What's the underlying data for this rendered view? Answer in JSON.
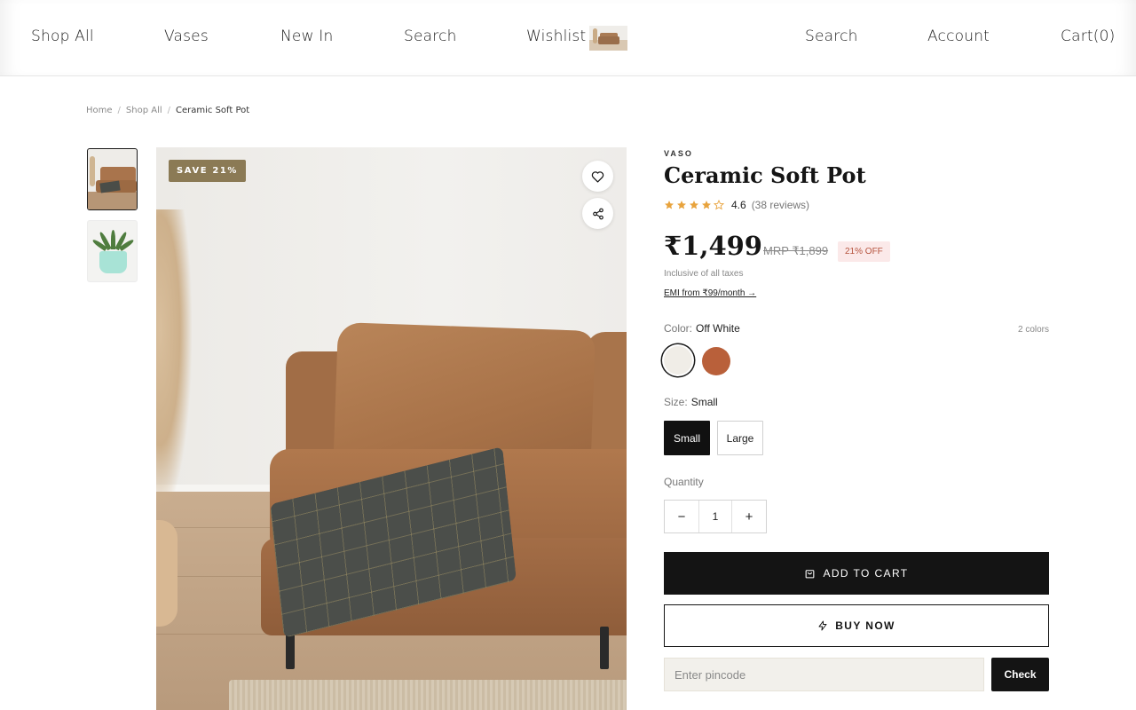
{
  "header": {
    "nav": [
      {
        "label": "Shop All"
      },
      {
        "label": "Vases"
      },
      {
        "label": "New In"
      },
      {
        "label": "Search"
      },
      {
        "label": "Wishlist"
      }
    ],
    "right_nav": [
      {
        "label": "Search"
      },
      {
        "label": "Account"
      },
      {
        "label": "Cart(0)"
      }
    ]
  },
  "breadcrumb": {
    "items": [
      "Home",
      "Shop All",
      "Ceramic Soft Pot"
    ],
    "separator": "/"
  },
  "gallery": {
    "badge": "SAVE 21%",
    "thumbnails": [
      {
        "subject": "leather sofa with plaid throw",
        "selected": true
      },
      {
        "subject": "succulent in mint pot",
        "selected": false
      }
    ],
    "wishlist_icon": "heart-icon",
    "share_icon": "share-icon"
  },
  "product": {
    "brand": "VASO",
    "title": "Ceramic Soft Pot",
    "rating": {
      "value": "4.6",
      "count": "(38 reviews)",
      "stars": 4,
      "star_color": "#e8a33d"
    },
    "price": "₹1,499",
    "mrp": "MRP ₹1,899",
    "discount": "21% OFF",
    "tax_note": "Inclusive of all taxes",
    "emi": "EMI from ₹99/month →",
    "color": {
      "label": "Color:",
      "selected": "Off White",
      "count": "2 colors",
      "swatches": [
        {
          "name": "Off White",
          "hex": "#f0ede7",
          "selected": true
        },
        {
          "name": "Terracotta",
          "hex": "#b9603a",
          "selected": false
        }
      ]
    },
    "size": {
      "label": "Size:",
      "selected": "Small",
      "options": [
        {
          "label": "Small",
          "selected": true
        },
        {
          "label": "Large",
          "selected": false
        }
      ]
    },
    "quantity": {
      "label": "Quantity",
      "value": "1",
      "decrement": "−",
      "increment": "+"
    },
    "add_to_cart": "ADD TO CART",
    "buy_now": "BUY NOW",
    "pincode": {
      "placeholder": "Enter pincode",
      "value": "",
      "button": "Check"
    }
  },
  "colors": {
    "accent": "#141414",
    "badge_bg": "#8b7a55",
    "discount_bg": "#fbe9e9",
    "discount_text": "#b5533d"
  }
}
